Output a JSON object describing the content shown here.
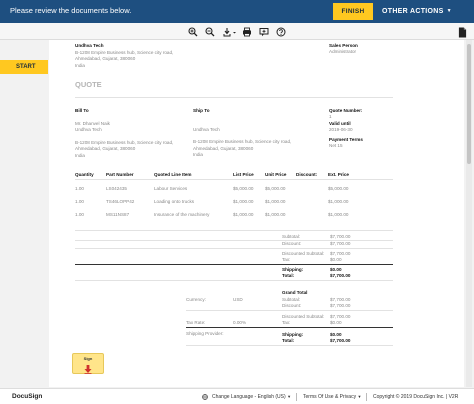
{
  "topbar": {
    "message": "Please review the documents below.",
    "finish_label": "FINISH",
    "other_actions_label": "OTHER ACTIONS",
    "other_actions_caret": "▼"
  },
  "toolbar": {
    "icons": [
      "zoom-in-icon",
      "zoom-out-icon",
      "download-icon",
      "print-icon",
      "comment-icon",
      "help-icon",
      "document-panel-icon"
    ]
  },
  "start_label": "START",
  "document": {
    "company_name": "Undhva Tech",
    "company_addr1": "B-1208 Empire Business hub, Science city road,",
    "company_addr2": "Ahmedabad, Gujarat, 380060",
    "company_country": "India",
    "sales_person_label": "Sales Person",
    "sales_person_value": "Administrator",
    "quote_heading": "QUOTE",
    "bill_to_label": "Bill To",
    "bill_to_name": "Mr. Dhanvel Naik",
    "bill_to_company": "Undhva Tech",
    "bill_to_addr1": "B-1208 Empire Business hub, Science city road,",
    "bill_to_addr2": "Ahmedabad, Gujarat, 380060",
    "bill_to_country": "India",
    "ship_to_label": "Ship To",
    "ship_to_company": "Undhva Tech",
    "ship_to_addr1": "B-1208 Empire Business hub, Science city road,",
    "ship_to_addr2": "Ahmedabad, Gujarat, 380060",
    "ship_to_country": "India",
    "quote_number_label": "Quote Number:",
    "quote_number_value": "1",
    "valid_until_label": "Valid until",
    "valid_until_value": "2019-06-30",
    "payment_terms_label": "Payment Terms",
    "payment_terms_value": "Net 15",
    "table_headers": [
      "Quantity",
      "Part Number",
      "Quoted Line Item",
      "List Price",
      "Unit Price",
      "Discount:",
      "Ext. Price"
    ],
    "rows": [
      [
        "1.00",
        "LS042435",
        "Labour Services",
        "$5,000.00",
        "$5,000.00",
        "",
        "$5,000.00"
      ],
      [
        "1.00",
        "TS46LOPP42",
        "Loading onto trucks",
        "$1,000.00",
        "$1,000.00",
        "",
        "$1,000.00"
      ],
      [
        "1.00",
        "MS11NS87",
        "Insurance of the machinery",
        "$1,000.00",
        "$1,000.00",
        "",
        "$1,000.00"
      ]
    ],
    "totals1": [
      {
        "label": "Subtotal:",
        "value": "$7,700.00",
        "bold": false
      },
      {
        "label": "Discount:",
        "value": "$7,700.00",
        "bold": false
      },
      {
        "label": "Discounted Subtotal:",
        "value": "$7,700.00",
        "bold": false
      },
      {
        "label": "Tax:",
        "value": "$0.00",
        "bold": false
      },
      {
        "label": "Shipping:",
        "value": "$0.00",
        "bold": true
      },
      {
        "label": "Total:",
        "value": "$7,700.00",
        "bold": true
      }
    ],
    "grand_total_label": "Grand Total",
    "currency_label": "Currency:",
    "currency_value": "USD",
    "tax_rate_label": "Tax Rate:",
    "tax_rate_value": "0.00%",
    "shipping_provider_label": "Shipping Provider:",
    "totals2": [
      {
        "label": "Subtotal:",
        "value": "$7,700.00",
        "bold": false
      },
      {
        "label": "Discount:",
        "value": "$7,700.00",
        "bold": false
      },
      {
        "label": "Discounted Subtotal:",
        "value": "$7,700.00",
        "bold": false
      },
      {
        "label": "Tax:",
        "value": "$0.00",
        "bold": false
      },
      {
        "label": "Shipping:",
        "value": "$0.00",
        "bold": true
      },
      {
        "label": "Total:",
        "value": "$7,700.00",
        "bold": true
      }
    ],
    "sign_label": "Sign"
  },
  "footer": {
    "brand": "DocuSign",
    "language": "Change Language - English (US)",
    "language_caret": "▼",
    "terms": "Terms Of Use & Privacy",
    "terms_caret": "▼",
    "copyright": "Copyright © 2019 DocuSign Inc. | V2R"
  },
  "colors": {
    "topbar": "#1e4f80",
    "accent_yellow": "#ffc820",
    "sign_tag": "#ffe58a"
  }
}
